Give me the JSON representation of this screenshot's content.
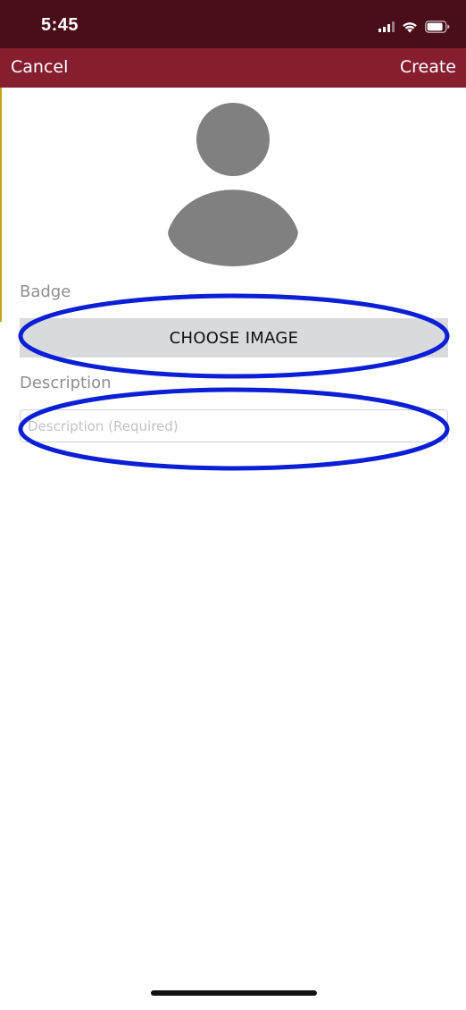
{
  "status_bar": {
    "time": "5:45",
    "icons": [
      "signal-icon",
      "wifi-icon",
      "battery-icon"
    ]
  },
  "nav": {
    "cancel_label": "Cancel",
    "create_label": "Create"
  },
  "form": {
    "avatar_icon": "person-placeholder-icon",
    "badge_label": "Badge",
    "choose_image_label": "CHOOSE IMAGE",
    "description_label": "Description",
    "description_placeholder": "Description (Required)",
    "description_value": ""
  },
  "colors": {
    "status_bar_bg": "#4a0e1a",
    "nav_bar_bg": "#861e30",
    "annotation_outline": "#0a1fd6",
    "button_bg": "#d9dadb"
  }
}
